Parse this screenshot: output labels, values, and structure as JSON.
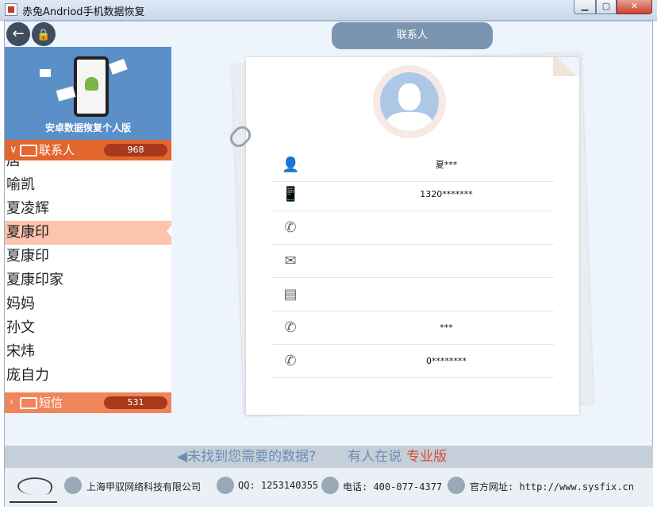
{
  "window": {
    "title": "赤兔Andriod手机数据恢复",
    "minimize": "▁",
    "maximize": "▢",
    "close": "✕"
  },
  "nav": {
    "back_icon": "←",
    "lock_icon": "🔒"
  },
  "tab_header": "联系人",
  "banner": {
    "caption": "安卓数据恢复个人版"
  },
  "sections": {
    "contacts": {
      "chevron": "∨",
      "label": "联系人",
      "count": "968"
    },
    "sms": {
      "chevron": "›",
      "label": "短信",
      "count": "531"
    }
  },
  "contacts": [
    {
      "name": "居一"
    },
    {
      "name": "喻凯"
    },
    {
      "name": "夏凌辉"
    },
    {
      "name": "夏康印"
    },
    {
      "name": "夏康印"
    },
    {
      "name": "夏康印家"
    },
    {
      "name": "妈妈"
    },
    {
      "name": "孙文"
    },
    {
      "name": "宋炜"
    },
    {
      "name": "庞自力"
    }
  ],
  "selected_index": 3,
  "details": [
    {
      "icon": "person-icon",
      "glyph": "👤",
      "value": "夏***"
    },
    {
      "icon": "mobile-icon",
      "glyph": "📱",
      "value": "1320*******"
    },
    {
      "icon": "phone-icon",
      "glyph": "✆",
      "value": ""
    },
    {
      "icon": "email-icon",
      "glyph": "✉",
      "value": ""
    },
    {
      "icon": "contact-card-icon",
      "glyph": "▤",
      "value": ""
    },
    {
      "icon": "call-info-icon",
      "glyph": "✆",
      "value": "***"
    },
    {
      "icon": "call-history-icon",
      "glyph": "✆",
      "value": "0********"
    }
  ],
  "promo": {
    "speaker": "◀",
    "question": "未找到您需要的数据?",
    "who": "有人在说",
    "pro": "专业版"
  },
  "footer": {
    "company": "上海甲驭网络科技有限公司",
    "qq": "QQ: 1253140355",
    "phone": "电话: 400-077-4377",
    "site": "官方网址: http://www.sysfix.cn"
  }
}
